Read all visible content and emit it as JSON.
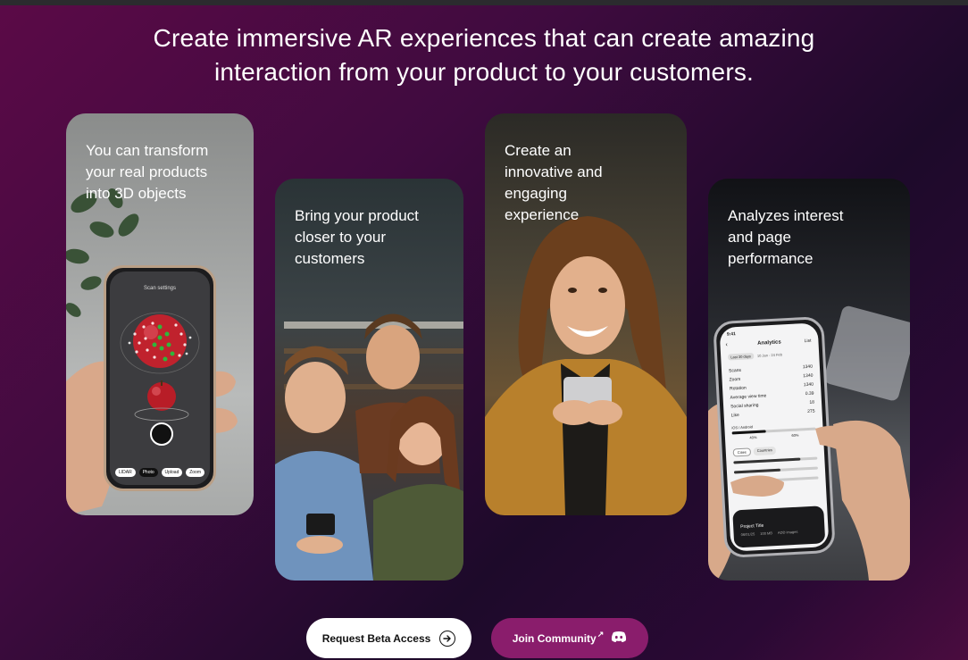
{
  "hero": {
    "title_line1": "Create immersive AR experiences that can create amazing",
    "title_line2": "interaction from your product to your customers."
  },
  "cards": [
    {
      "caption_line1": "You can transform",
      "caption_line2": "your real products",
      "caption_line3": "into 3D objects",
      "phone": {
        "screen_title": "Scan settings",
        "modes": [
          "LIDAR",
          "Photo",
          "Upload",
          "Zoom"
        ]
      }
    },
    {
      "caption_line1": "Bring your product",
      "caption_line2": "closer to your",
      "caption_line3": "customers"
    },
    {
      "caption_line1": "Create an",
      "caption_line2": "innovative and",
      "caption_line3": "engaging",
      "caption_line4": "experience"
    },
    {
      "caption_line1": "Analyzes interest",
      "caption_line2": "and page",
      "caption_line3": "performance",
      "phone": {
        "time": "9:41",
        "screen_title": "Analytics",
        "right_link": "List",
        "filter": "Last 30 days",
        "date_range": "10 Jan - 24 Feb",
        "metrics": [
          {
            "label": "Scans",
            "value": "1340"
          },
          {
            "label": "Zoom",
            "value": "1340"
          },
          {
            "label": "Rotation",
            "value": "1340"
          },
          {
            "label": "Average view time",
            "value": "0.39"
          },
          {
            "label": "Social sharing",
            "value": "18"
          },
          {
            "label": "Like",
            "value": "275"
          }
        ],
        "platform_label": "iOS / Android",
        "platform_left": "40%",
        "platform_right": "60%",
        "tabs": [
          "Cities",
          "Countries"
        ],
        "project_title": "Project Title",
        "project_date": "06/01/25",
        "project_size": "100 MB",
        "project_extra": "ADD images"
      }
    }
  ],
  "buttons": {
    "request_label": "Request Beta Access",
    "join_label": "Join Community",
    "external_mark": "↗"
  },
  "colors": {
    "join_button": "#8a1d6c",
    "primary_button": "#ffffff"
  }
}
